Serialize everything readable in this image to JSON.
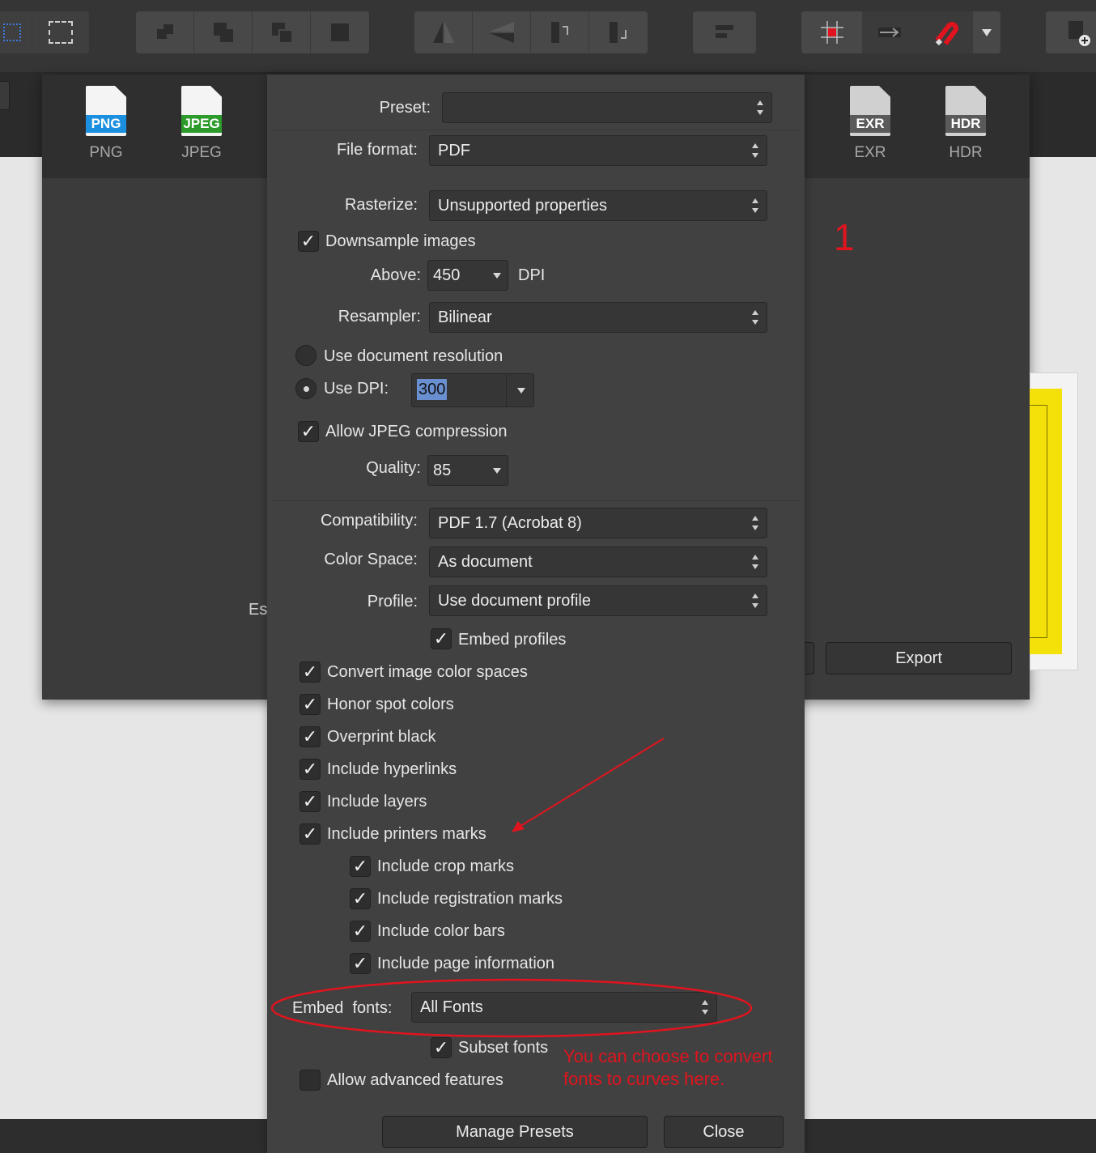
{
  "toolbar": {
    "icons": [
      "grid-select-icon",
      "transform-icon",
      "arrange-back-icon",
      "arrange-backward-icon",
      "arrange-forward-icon",
      "arrange-front-icon",
      "flip-horizontal-icon",
      "flip-vertical-icon",
      "rotate-left-icon",
      "rotate-right-icon",
      "align-icon",
      "snapping-grid-icon",
      "move-icon",
      "snapping-magnet-icon",
      "dropdown-icon",
      "add-page-icon"
    ]
  },
  "formats": [
    {
      "badge": "PNG",
      "label": "PNG",
      "color": "#1b8fe0"
    },
    {
      "badge": "JPEG",
      "label": "JPEG",
      "color": "#2c9b2c"
    },
    {
      "badge": "EXR",
      "label": "EXR",
      "color": "#5a5a5a"
    },
    {
      "badge": "HDR",
      "label": "HDR",
      "color": "#5a5a5a"
    }
  ],
  "export_dialog": {
    "estimate_label": "Es",
    "export_button": "Export"
  },
  "annotation": {
    "number": "1",
    "note_line1": "You can choose to convert",
    "note_line2": "fonts to curves here."
  },
  "panel": {
    "preset": {
      "label": "Preset:",
      "value": ""
    },
    "file_format": {
      "label": "File format:",
      "value": "PDF"
    },
    "rasterize": {
      "label": "Rasterize:",
      "value": "Unsupported properties"
    },
    "downsample": {
      "label": "Downsample images",
      "checked": true
    },
    "above": {
      "label": "Above:",
      "value": "450",
      "unit": "DPI"
    },
    "resampler": {
      "label": "Resampler:",
      "value": "Bilinear"
    },
    "use_doc_res": {
      "label": "Use document resolution",
      "selected": false
    },
    "use_dpi": {
      "label": "Use DPI:",
      "value": "300",
      "selected": true
    },
    "allow_jpeg": {
      "label": "Allow JPEG compression",
      "checked": true
    },
    "quality": {
      "label": "Quality:",
      "value": "85"
    },
    "compatibility": {
      "label": "Compatibility:",
      "value": "PDF 1.7 (Acrobat 8)"
    },
    "color_space": {
      "label": "Color Space:",
      "value": "As document"
    },
    "profile": {
      "label": "Profile:",
      "value": "Use document profile"
    },
    "embed_profiles": {
      "label": "Embed profiles",
      "checked": true
    },
    "checks": [
      {
        "label": "Convert image color spaces",
        "checked": true
      },
      {
        "label": "Honor spot colors",
        "checked": true
      },
      {
        "label": "Overprint black",
        "checked": true
      },
      {
        "label": "Include hyperlinks",
        "checked": true
      },
      {
        "label": "Include layers",
        "checked": true
      },
      {
        "label": "Include printers marks",
        "checked": true
      }
    ],
    "sub_checks": [
      {
        "label": "Include crop marks",
        "checked": true
      },
      {
        "label": "Include registration marks",
        "checked": true
      },
      {
        "label": "Include color bars",
        "checked": true
      },
      {
        "label": "Include page information",
        "checked": true
      }
    ],
    "embed_fonts": {
      "label": "Embed  fonts:",
      "value": "All Fonts"
    },
    "subset_fonts": {
      "label": "Subset fonts",
      "checked": true
    },
    "advanced": {
      "label": "Allow advanced features",
      "checked": false
    },
    "manage_presets": "Manage Presets",
    "close": "Close"
  },
  "colors": {
    "annotation_red": "#e0141e",
    "highlight": "#6a8fd0"
  }
}
